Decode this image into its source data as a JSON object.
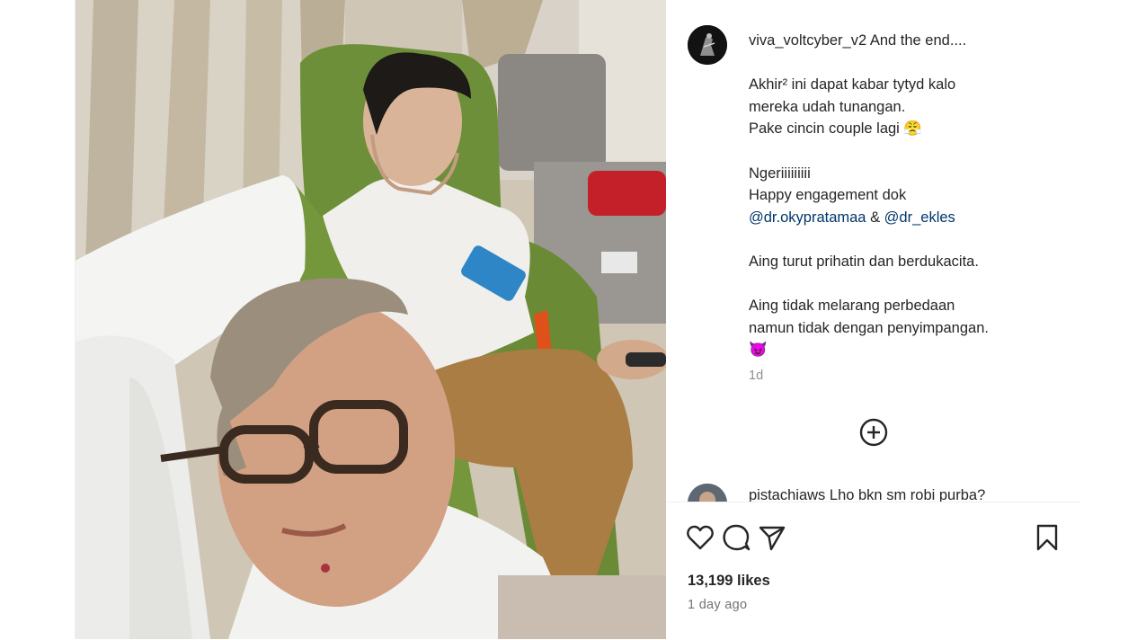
{
  "post": {
    "username": "viva_voltcyber_v2",
    "caption_lines": [
      "And the end....",
      "",
      "Akhir² ini dapat kabar tytyd kalo",
      "mereka udah tunangan.",
      "Pake cincin couple lagi 😤",
      "",
      "Ngeriiiiiiiii",
      "Happy engagement dok",
      "",
      "",
      "Aing turut prihatin dan berdukacita.",
      "",
      "Aing tidak melarang perbedaan",
      "namun tidak dengan penyimpangan.",
      "😈"
    ],
    "mention_1": "@dr.okypratamaa",
    "mention_sep": " & ",
    "mention_2": "@dr_ekles",
    "time_short": "1d"
  },
  "comments": [
    {
      "username": "pistachiaws",
      "text": "Lho bkn sm robi purba?"
    }
  ],
  "icons": {
    "like": "heart-icon",
    "comment": "comment-icon",
    "share": "share-icon",
    "save": "bookmark-icon",
    "more_comments": "plus-circle-icon"
  },
  "footer": {
    "likes": "13,199 likes",
    "time_ago": "1 day ago"
  }
}
